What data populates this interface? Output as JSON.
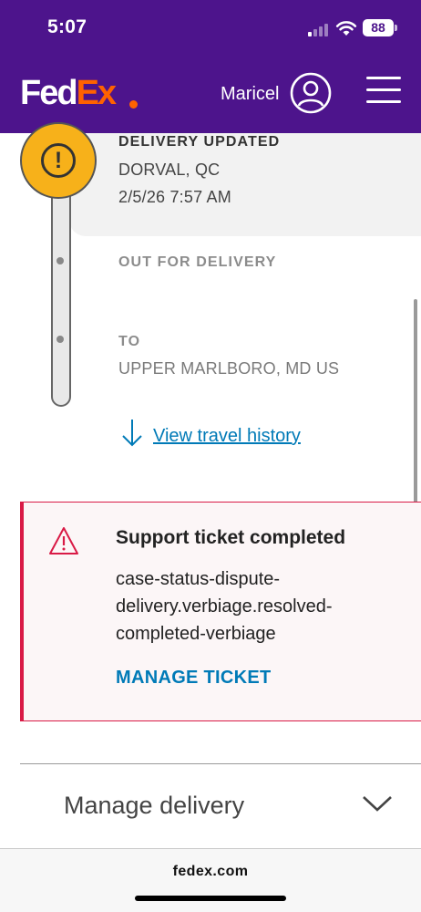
{
  "status_bar": {
    "time": "5:07",
    "battery": "88"
  },
  "header": {
    "logo": {
      "part1": "Fed",
      "part2": "Ex"
    },
    "username": "Maricel",
    "colors": {
      "brand_purple": "#4d148c",
      "brand_orange": "#ff6200"
    },
    "icons": {
      "account": "user-circle-icon",
      "menu": "hamburger-menu-icon"
    }
  },
  "timeline": {
    "current": {
      "label": "DELIVERY UPDATED",
      "location": "DORVAL, QC",
      "timestamp": "2/5/26 7:57 AM",
      "icon": "exclamation-circle-icon",
      "color": "#f7b11a"
    },
    "steps": [
      {
        "label": "OUT FOR DELIVERY"
      },
      {
        "label": "TO",
        "value": "UPPER MARLBORO, MD US"
      }
    ],
    "history_link": "View travel history"
  },
  "support_alert": {
    "icon": "warning-triangle-icon",
    "title": "Support ticket completed",
    "body_lines": [
      "case-status-dispute-",
      "delivery.verbiage.resolved-",
      "completed-verbiage"
    ],
    "action": "MANAGE TICKET",
    "color": "#d91a46"
  },
  "manage_delivery": {
    "label": "Manage delivery",
    "icon": "chevron-down-icon"
  },
  "browser": {
    "url": "fedex.com"
  }
}
